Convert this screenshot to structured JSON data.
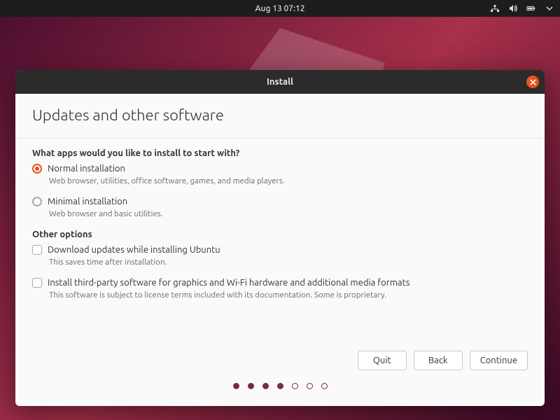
{
  "topbar": {
    "datetime": "Aug 13  07:12"
  },
  "window": {
    "title": "Install"
  },
  "page": {
    "title": "Updates and other software",
    "question": "What apps would you like to install to start with?",
    "options": {
      "normal": {
        "label": "Normal installation",
        "desc": "Web browser, utilities, office software, games, and media players."
      },
      "minimal": {
        "label": "Minimal installation",
        "desc": "Web browser and basic utilities."
      }
    },
    "other_heading": "Other options",
    "checks": {
      "updates": {
        "label": "Download updates while installing Ubuntu",
        "desc": "This saves time after installation."
      },
      "thirdparty": {
        "label": "Install third-party software for graphics and Wi-Fi hardware and additional media formats",
        "desc": "This software is subject to license terms included with its documentation. Some is proprietary."
      }
    },
    "buttons": {
      "quit": "Quit",
      "back": "Back",
      "continue": "Continue"
    }
  },
  "pager": {
    "total": 7,
    "current": 4
  }
}
